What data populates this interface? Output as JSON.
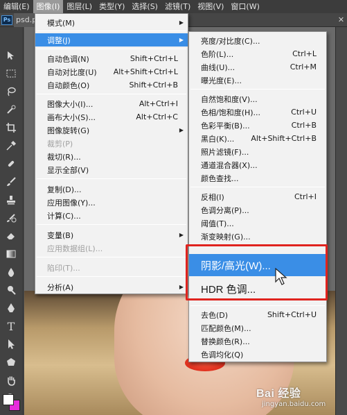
{
  "menubar": {
    "items": [
      "编辑(E)",
      "图像(I)",
      "图层(L)",
      "类型(Y)",
      "选择(S)",
      "滤镜(T)",
      "视图(V)",
      "窗口(W)"
    ],
    "active_index": 1
  },
  "doc_tab": {
    "title": "psd.ps"
  },
  "ps_logo": "Ps",
  "image_menu": {
    "items": [
      {
        "label": "模式(M)",
        "shortcut": "",
        "submenu": true,
        "disabled": false
      },
      {
        "label": "调整(J)",
        "shortcut": "",
        "submenu": true,
        "disabled": false,
        "highlight": true
      },
      {
        "label": "自动色调(N)",
        "shortcut": "Shift+Ctrl+L"
      },
      {
        "label": "自动对比度(U)",
        "shortcut": "Alt+Shift+Ctrl+L"
      },
      {
        "label": "自动颜色(O)",
        "shortcut": "Shift+Ctrl+B"
      },
      {
        "label": "图像大小(I)...",
        "shortcut": "Alt+Ctrl+I"
      },
      {
        "label": "画布大小(S)...",
        "shortcut": "Alt+Ctrl+C"
      },
      {
        "label": "图像旋转(G)",
        "shortcut": "",
        "submenu": true
      },
      {
        "label": "裁剪(P)",
        "shortcut": "",
        "disabled": true
      },
      {
        "label": "裁切(R)...",
        "shortcut": ""
      },
      {
        "label": "显示全部(V)",
        "shortcut": ""
      },
      {
        "label": "复制(D)...",
        "shortcut": ""
      },
      {
        "label": "应用图像(Y)...",
        "shortcut": ""
      },
      {
        "label": "计算(C)...",
        "shortcut": ""
      },
      {
        "label": "变量(B)",
        "shortcut": "",
        "submenu": true
      },
      {
        "label": "应用数据组(L)...",
        "shortcut": "",
        "disabled": true
      },
      {
        "label": "陷印(T)...",
        "shortcut": "",
        "disabled": true
      },
      {
        "label": "分析(A)",
        "shortcut": "",
        "submenu": true
      }
    ]
  },
  "adjust_menu": {
    "items": [
      {
        "label": "亮度/对比度(C)...",
        "shortcut": ""
      },
      {
        "label": "色阶(L)...",
        "shortcut": "Ctrl+L"
      },
      {
        "label": "曲线(U)...",
        "shortcut": "Ctrl+M"
      },
      {
        "label": "曝光度(E)...",
        "shortcut": ""
      },
      {
        "label": "自然饱和度(V)...",
        "shortcut": ""
      },
      {
        "label": "色相/饱和度(H)...",
        "shortcut": "Ctrl+U"
      },
      {
        "label": "色彩平衡(B)...",
        "shortcut": "Ctrl+B"
      },
      {
        "label": "黑白(K)...",
        "shortcut": "Alt+Shift+Ctrl+B"
      },
      {
        "label": "照片滤镜(F)...",
        "shortcut": ""
      },
      {
        "label": "通道混合器(X)...",
        "shortcut": ""
      },
      {
        "label": "颜色查找...",
        "shortcut": ""
      },
      {
        "label": "反相(I)",
        "shortcut": "Ctrl+I"
      },
      {
        "label": "色调分离(P)...",
        "shortcut": ""
      },
      {
        "label": "阈值(T)...",
        "shortcut": ""
      },
      {
        "label": "渐变映射(G)...",
        "shortcut": ""
      },
      {
        "label": "阴影/高光(W)...",
        "shortcut": "",
        "highlight": true
      },
      {
        "label": "HDR 色调...",
        "shortcut": ""
      },
      {
        "label": "去色(D)",
        "shortcut": "Shift+Ctrl+U"
      },
      {
        "label": "匹配颜色(M)...",
        "shortcut": ""
      },
      {
        "label": "替换颜色(R)...",
        "shortcut": ""
      },
      {
        "label": "色调均化(Q)",
        "shortcut": ""
      }
    ]
  },
  "watermark": {
    "logo": "Bai 经验",
    "url": "jingyan.baidu.com"
  },
  "colors": {
    "highlight": "#3a8ee6",
    "annotation_box": "#e0231e",
    "foreground_swatch": "#ffffff",
    "background_swatch": "#e62bdc"
  },
  "tools": [
    "move-icon",
    "marquee-icon",
    "lasso-icon",
    "quick-select-icon",
    "crop-icon",
    "eyedropper-icon",
    "healing-brush-icon",
    "brush-icon",
    "clone-stamp-icon",
    "history-brush-icon",
    "eraser-icon",
    "gradient-icon",
    "blur-icon",
    "dodge-icon",
    "pen-icon",
    "type-icon",
    "path-select-icon",
    "shape-icon",
    "hand-icon",
    "zoom-icon"
  ]
}
